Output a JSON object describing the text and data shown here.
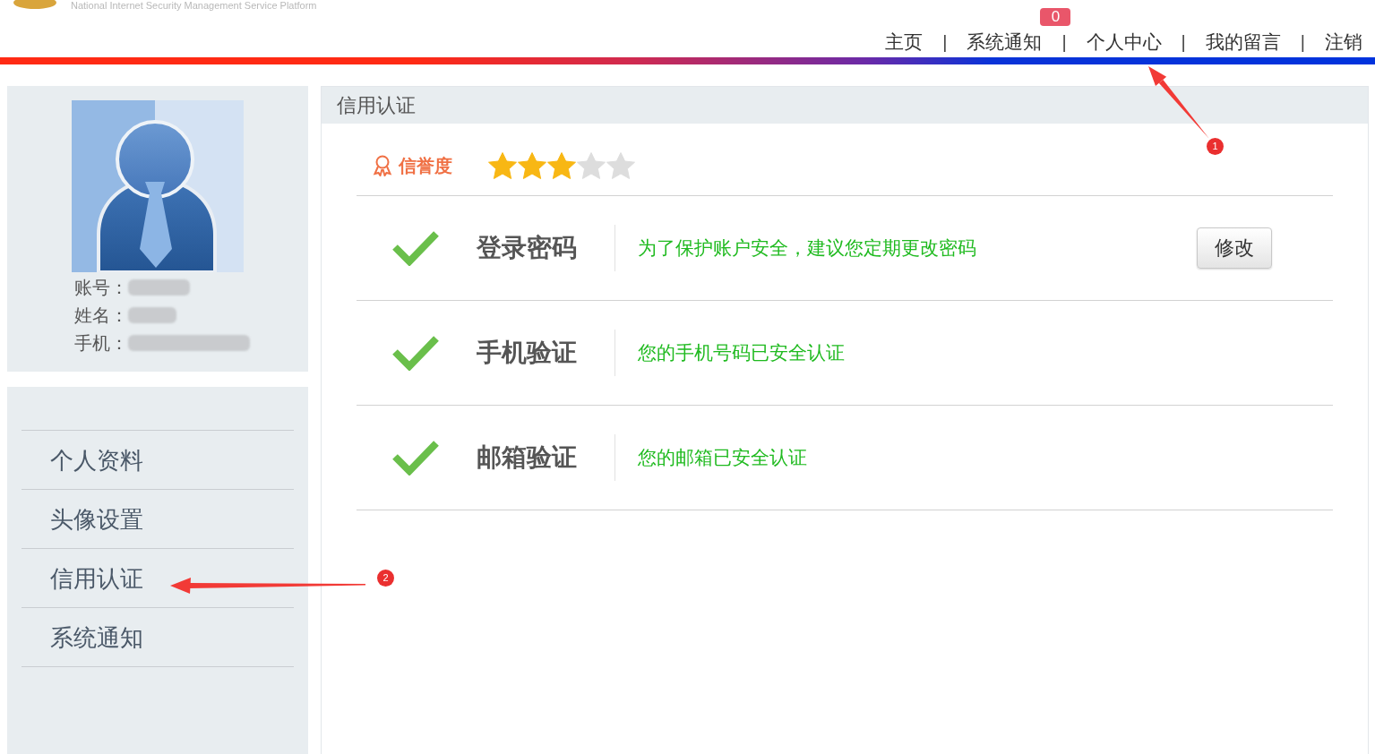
{
  "header": {
    "tagline": "National Internet Security Management Service Platform",
    "nav": [
      {
        "label": "主页",
        "separator": "|"
      },
      {
        "label": "系统通知",
        "badge": "0",
        "separator": "|"
      },
      {
        "label": "个人中心",
        "separator": "|"
      },
      {
        "label": "我的留言",
        "separator": "|"
      },
      {
        "label": "注销"
      }
    ]
  },
  "profile": {
    "fields": [
      {
        "label": "账号：",
        "redacted": true
      },
      {
        "label": "姓名：",
        "redacted": true
      },
      {
        "label": "手机：",
        "redacted": true
      }
    ]
  },
  "menu": {
    "items": [
      {
        "label": "个人资料"
      },
      {
        "label": "头像设置"
      },
      {
        "label": "信用认证"
      },
      {
        "label": "系统通知"
      }
    ]
  },
  "panel": {
    "title": "信用认证",
    "credit": {
      "label": "信誉度",
      "stars": 3
    },
    "rows": [
      {
        "verified": true,
        "title": "登录密码",
        "description": "为了保护账户安全，建议您定期更改密码",
        "button": "修改"
      },
      {
        "verified": true,
        "title": "手机验证",
        "description": "您的手机号码已安全认证"
      },
      {
        "verified": true,
        "title": "邮箱验证",
        "description": "您的邮箱已安全认证"
      }
    ]
  },
  "annotations": [
    {
      "label": "1"
    },
    {
      "label": "2"
    }
  ]
}
